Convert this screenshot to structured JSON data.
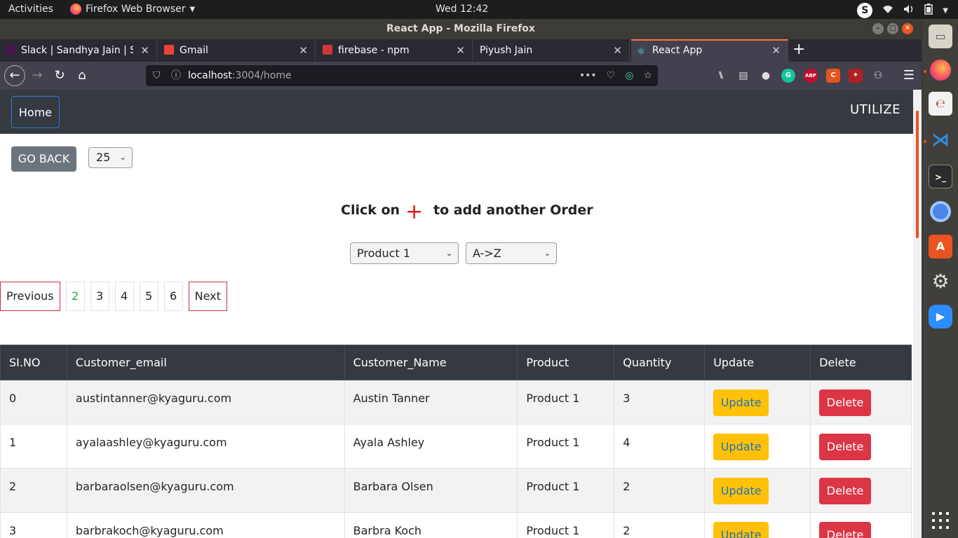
{
  "system": {
    "activities": "Activities",
    "app_menu": "Firefox Web Browser",
    "clock": "Wed 12:42"
  },
  "window": {
    "title": "React App - Mozilla Firefox"
  },
  "tabs": [
    {
      "label": "Slack | Sandhya Jain | Sar",
      "icon": "slack-icon",
      "color": "#4a154b"
    },
    {
      "label": "Gmail",
      "icon": "gmail-icon",
      "color": "#ea4335"
    },
    {
      "label": "firebase - npm",
      "icon": "npm-icon",
      "color": "#cb3837"
    },
    {
      "label": "Piyush Jain",
      "icon": "",
      "color": ""
    },
    {
      "label": "React App",
      "icon": "react-icon",
      "color": "#61dafb"
    }
  ],
  "urlbar": {
    "host": "localhost",
    "rest": ":3004/home"
  },
  "app": {
    "nav_home": "Home",
    "brand": "UTILIZE",
    "go_back": "GO BACK",
    "per_page": "25",
    "headline_prefix": "Click on",
    "headline_plus": "+",
    "headline_suffix": "to add another Order",
    "product_filter": "Product 1",
    "sort_order": "A->Z"
  },
  "pagination": {
    "previous": "Previous",
    "pages": [
      "2",
      "3",
      "4",
      "5",
      "6"
    ],
    "current": "2",
    "next": "Next"
  },
  "table": {
    "headers": [
      "SI.NO",
      "Customer_email",
      "Customer_Name",
      "Product",
      "Quantity",
      "Update",
      "Delete"
    ],
    "rows": [
      {
        "sino": "0",
        "email": "austintanner@kyaguru.com",
        "name": "Austin Tanner",
        "product": "Product 1",
        "qty": "3"
      },
      {
        "sino": "1",
        "email": "ayalaashley@kyaguru.com",
        "name": "Ayala Ashley",
        "product": "Product 1",
        "qty": "4"
      },
      {
        "sino": "2",
        "email": "barbaraolsen@kyaguru.com",
        "name": "Barbara Olsen",
        "product": "Product 1",
        "qty": "2"
      },
      {
        "sino": "3",
        "email": "barbrakoch@kyaguru.com",
        "name": "Barbra Koch",
        "product": "Product 1",
        "qty": "2"
      }
    ],
    "update_label": "Update",
    "delete_label": "Delete"
  },
  "colors": {
    "navbar": "#343a40",
    "update_button": "#ffc107",
    "delete_button": "#dc3545",
    "go_back_button": "#6c757d",
    "plus": "#e0191f",
    "current_page": "#28a745"
  }
}
